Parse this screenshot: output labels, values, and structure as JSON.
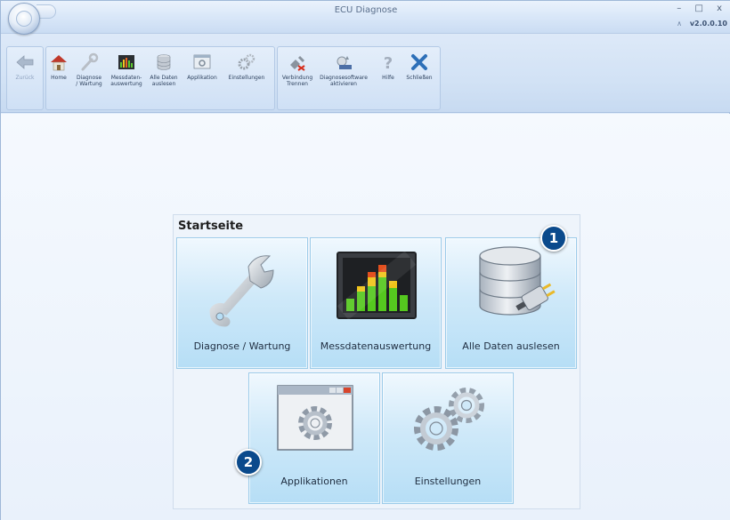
{
  "window": {
    "title": "ECU Diagnose",
    "version": "v2.0.0.10",
    "controls": [
      "–",
      "□",
      "x"
    ]
  },
  "ribbon": {
    "back": {
      "label": "Zurück",
      "enabled": false,
      "icon": "back-arrow-icon"
    },
    "nav_buttons": [
      {
        "line1": "Home",
        "line2": "",
        "icon": "home-icon"
      },
      {
        "line1": "Diagnose",
        "line2": "/ Wartung",
        "icon": "wrench-icon"
      },
      {
        "line1": "Messdaten-",
        "line2": "auswertung",
        "icon": "equalizer-icon"
      },
      {
        "line1": "Alle Daten",
        "line2": "auslesen",
        "icon": "database-icon"
      },
      {
        "line1": "Applikation",
        "line2": "",
        "icon": "application-window-icon"
      },
      {
        "line1": "Einstellungen",
        "line2": "",
        "icon": "gears-icon"
      }
    ],
    "tool_buttons": [
      {
        "line1": "Verbindung",
        "line2": "Trennen",
        "icon": "disconnect-plug-icon"
      },
      {
        "line1": "Diagnosesoftware",
        "line2": "aktivieren",
        "icon": "activate-software-icon"
      },
      {
        "line1": "Hilfe",
        "line2": "",
        "icon": "help-question-icon"
      },
      {
        "line1": "Schließen",
        "line2": "",
        "icon": "close-x-icon"
      }
    ]
  },
  "startpage": {
    "title": "Startseite",
    "tiles": [
      {
        "label": "Diagnose / Wartung",
        "icon": "wrench-icon"
      },
      {
        "label": "Messdatenauswertung",
        "icon": "equalizer-icon"
      },
      {
        "label": "Alle Daten auslesen",
        "icon": "database-icon"
      },
      {
        "label": "Applikationen",
        "icon": "application-window-icon"
      },
      {
        "label": "Einstellungen",
        "icon": "gears-icon"
      }
    ],
    "callouts": [
      "1",
      "2"
    ]
  },
  "colors": {
    "callout": "#0b4a8c",
    "tile_light": "#f0f8fe",
    "tile_dark": "#b6def6",
    "ribbon": "#d2e2f5"
  }
}
